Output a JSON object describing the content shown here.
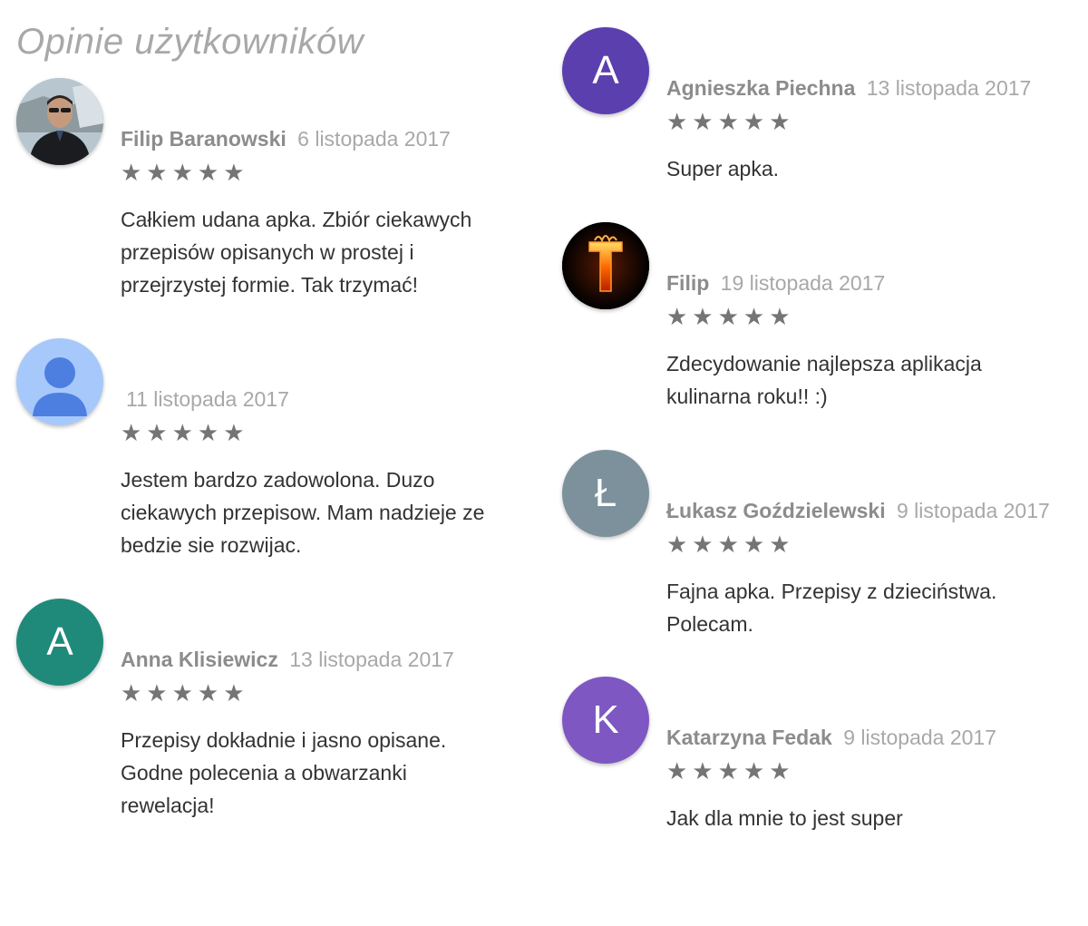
{
  "page": {
    "title": "Opinie użytkowników"
  },
  "reviews": [
    {
      "author": "Filip Baranowski",
      "date": "6 listopada 2017",
      "rating": 5,
      "stars": "★★★★★",
      "text": "Całkiem udana apka. Zbiór ciekawych przepisów opisanych w prostej i przejrzystej formie. Tak trzymać!",
      "avatar": {
        "type": "photo",
        "icon": "person-photo"
      }
    },
    {
      "author": "",
      "date": "11 listopada 2017",
      "rating": 5,
      "stars": "★★★★★",
      "text": "Jestem bardzo zadowolona. Duzo ciekawych przepisow. Mam nadzieje ze bedzie sie rozwijac.",
      "avatar": {
        "type": "default",
        "icon": "default-user-icon",
        "bg": "#a7c8fb",
        "fg": "#4c7fe0"
      }
    },
    {
      "author": "Anna Klisiewicz",
      "date": "13 listopada 2017",
      "rating": 5,
      "stars": "★★★★★",
      "text": "Przepisy dokładnie i jasno opisane. Godne polecenia a obwarzanki rewelacja!",
      "avatar": {
        "type": "letter",
        "letter": "A",
        "bg": "#1f8a7a"
      }
    },
    {
      "author": "Agnieszka Piechna",
      "date": "13 listopada 2017",
      "rating": 5,
      "stars": "★★★★★",
      "text": "Super apka.",
      "avatar": {
        "type": "letter",
        "letter": "A",
        "bg": "#5b3fae"
      }
    },
    {
      "author": "Filip",
      "date": "19 listopada 2017",
      "rating": 5,
      "stars": "★★★★★",
      "text": "Zdecydowanie najlepsza aplikacja kulinarna roku!! :)",
      "avatar": {
        "type": "image",
        "icon": "fire-letter-t-icon",
        "letter": "T",
        "bg": "#000000"
      }
    },
    {
      "author": "Łukasz Goździelewski",
      "date": "9 listopada 2017",
      "rating": 5,
      "stars": "★★★★★",
      "text": "Fajna apka. Przepisy z dzieciństwa. Polecam.",
      "avatar": {
        "type": "letter",
        "letter": "Ł",
        "bg": "#7d919c"
      }
    },
    {
      "author": "Katarzyna Fedak",
      "date": "9 listopada 2017",
      "rating": 5,
      "stars": "★★★★★",
      "text": "Jak dla mnie to jest super",
      "avatar": {
        "type": "letter",
        "letter": "K",
        "bg": "#7e57c2"
      }
    }
  ]
}
